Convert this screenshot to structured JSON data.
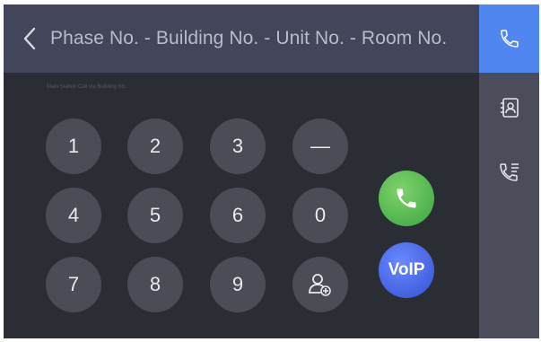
{
  "header": {
    "title": "Phase No. - Building No. - Unit No. - Room No.",
    "back_icon": "chevron-left-icon"
  },
  "hint": "Main Station Call via Building No.",
  "keypad": {
    "keys": [
      "1",
      "2",
      "3",
      "—",
      "4",
      "5",
      "6",
      "0",
      "7",
      "8",
      "9",
      "contact-add"
    ]
  },
  "actions": {
    "call_icon": "phone-icon",
    "voip_label": "VoIP"
  },
  "sidebar": {
    "items": [
      "call-icon",
      "contacts-icon",
      "call-log-icon"
    ],
    "active_color": "#4f86ef"
  },
  "colors": {
    "call_green": "#4caf50",
    "voip_blue": "#3d5bd9",
    "key_gray": "#4a4c56"
  }
}
